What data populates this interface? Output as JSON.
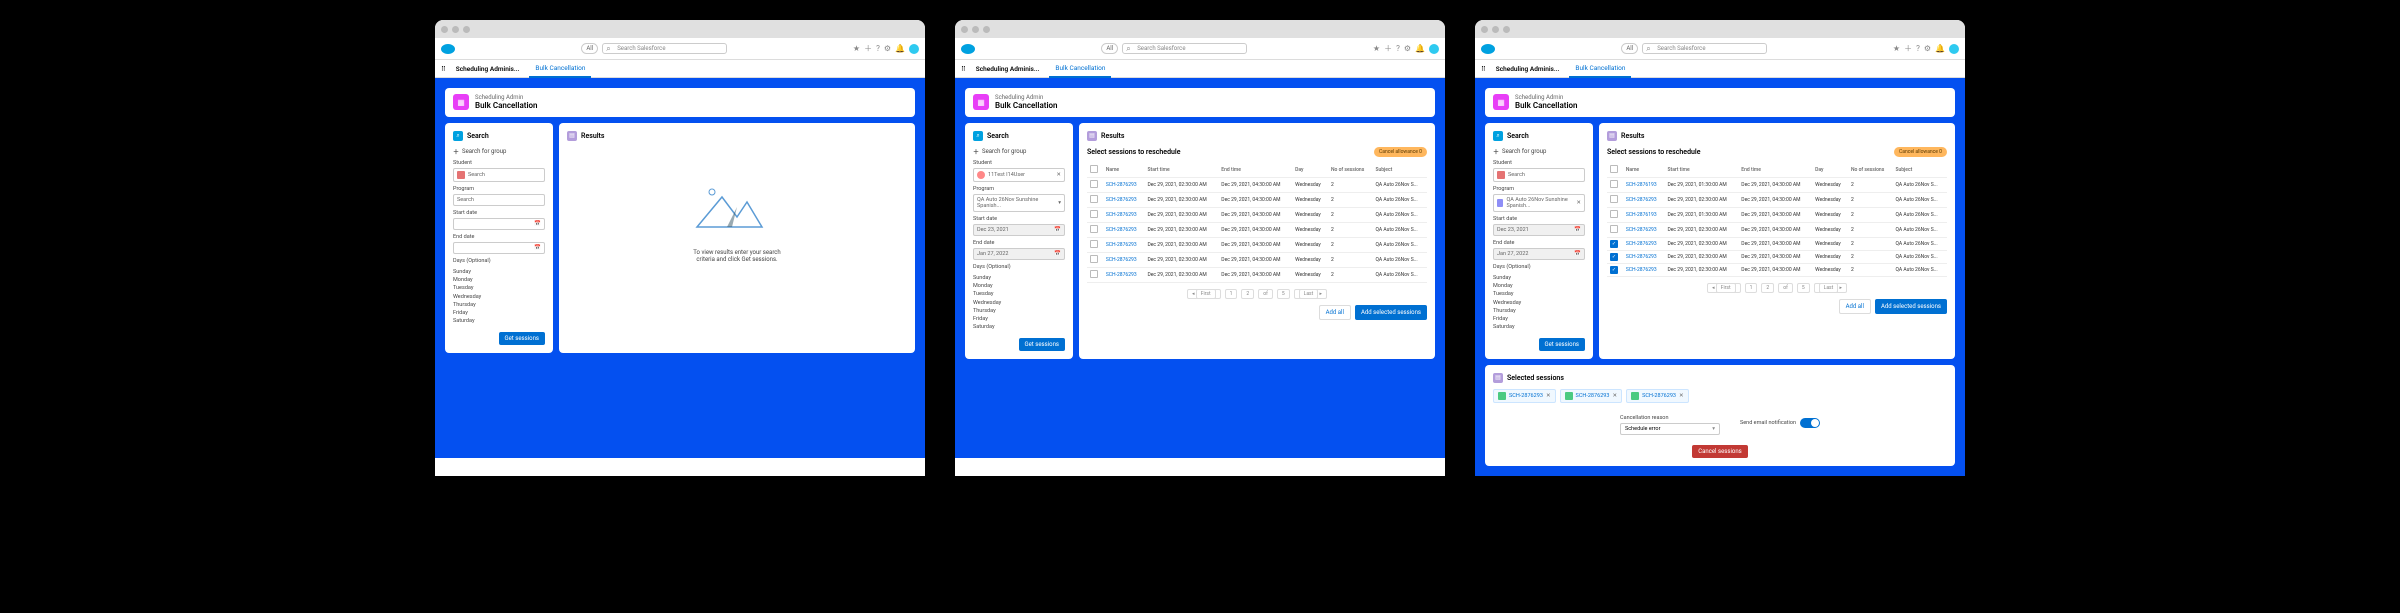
{
  "global": {
    "searchScope": "All",
    "searchPlaceholder": "Search Salesforce",
    "appName": "Scheduling Adminis...",
    "activeTab": "Bulk Cancellation",
    "header": {
      "sub": "Scheduling Admin",
      "main": "Bulk Cancellation"
    }
  },
  "searchCard": {
    "title": "Search",
    "searchGroup": "Search for group",
    "studentLabel": "Student",
    "searchPlaceholder": "Search",
    "programLabel": "Program",
    "startDateLabel": "Start date",
    "endDateLabel": "End date",
    "daysLabel": "Days (Optional)",
    "days": [
      "Sunday",
      "Monday",
      "Tuesday",
      "Wednesday",
      "Thursday",
      "Friday",
      "Saturday"
    ],
    "getBtn": "Get sessions"
  },
  "resultsCard": {
    "title": "Results",
    "emptyMsg1": "To view results enter your search",
    "emptyMsg2": "criteria and click Get sessions.",
    "selectTitle": "Select sessions to reschedule",
    "cancelAllowance": "Cancel allowance 0",
    "addAll": "Add all",
    "addSelected": "Add selected sessions",
    "pager": {
      "first": "First",
      "last": "Last",
      "page1": "1",
      "page2": "2",
      "of": "of",
      "total": "5"
    }
  },
  "columns": [
    "Name",
    "Start time",
    "End time",
    "Day",
    "No of sessions",
    "Subject"
  ],
  "panel2": {
    "student": "11Test I14User",
    "program": "QA Auto 26Nov Sunshine Spanish...",
    "startDate": "Dec 23, 2021",
    "endDate": "Jan 27, 2022",
    "rows": [
      {
        "name": "SCH-2876293",
        "start": "Dec 29, 2021, 02:30:00 AM",
        "end": "Dec 29, 2021, 04:30:00 AM",
        "day": "Wednesday",
        "n": "2",
        "subj": "QA Auto 26Nov S..."
      },
      {
        "name": "SCH-2876293",
        "start": "Dec 29, 2021, 02:30:00 AM",
        "end": "Dec 29, 2021, 04:30:00 AM",
        "day": "Wednesday",
        "n": "2",
        "subj": "QA Auto 26Nov S..."
      },
      {
        "name": "SCH-2876293",
        "start": "Dec 29, 2021, 02:30:00 AM",
        "end": "Dec 29, 2021, 04:30:00 AM",
        "day": "Wednesday",
        "n": "2",
        "subj": "QA Auto 26Nov S..."
      },
      {
        "name": "SCH-2876293",
        "start": "Dec 29, 2021, 02:30:00 AM",
        "end": "Dec 29, 2021, 04:30:00 AM",
        "day": "Wednesday",
        "n": "2",
        "subj": "QA Auto 26Nov S..."
      },
      {
        "name": "SCH-2876293",
        "start": "Dec 29, 2021, 02:30:00 AM",
        "end": "Dec 29, 2021, 04:30:00 AM",
        "day": "Wednesday",
        "n": "2",
        "subj": "QA Auto 26Nov S..."
      },
      {
        "name": "SCH-2876293",
        "start": "Dec 29, 2021, 02:30:00 AM",
        "end": "Dec 29, 2021, 04:30:00 AM",
        "day": "Wednesday",
        "n": "2",
        "subj": "QA Auto 26Nov S..."
      },
      {
        "name": "SCH-2876293",
        "start": "Dec 29, 2021, 02:30:00 AM",
        "end": "Dec 29, 2021, 04:30:00 AM",
        "day": "Wednesday",
        "n": "2",
        "subj": "QA Auto 26Nov S..."
      }
    ]
  },
  "panel3": {
    "student": "Search",
    "program": "QA Auto 26Nov Sunshine Spanish...",
    "startDate": "Dec 23, 2021",
    "endDate": "Jan 27, 2022",
    "rows": [
      {
        "chk": false,
        "name": "SCH-2876193",
        "start": "Dec 29, 2021, 01:30:00 AM",
        "end": "Dec 29, 2021, 04:30:00 AM",
        "day": "Wednesday",
        "n": "2",
        "subj": "QA Auto 26Nov S..."
      },
      {
        "chk": false,
        "name": "SCH-2876293",
        "start": "Dec 29, 2021, 02:30:00 AM",
        "end": "Dec 29, 2021, 04:30:00 AM",
        "day": "Wednesday",
        "n": "2",
        "subj": "QA Auto 26Nov S..."
      },
      {
        "chk": false,
        "name": "SCH-2876193",
        "start": "Dec 29, 2021, 01:30:00 AM",
        "end": "Dec 29, 2021, 04:30:00 AM",
        "day": "Wednesday",
        "n": "2",
        "subj": "QA Auto 26Nov S..."
      },
      {
        "chk": false,
        "name": "SCH-2876293",
        "start": "Dec 29, 2021, 02:30:00 AM",
        "end": "Dec 29, 2021, 04:30:00 AM",
        "day": "Wednesday",
        "n": "2",
        "subj": "QA Auto 26Nov S..."
      },
      {
        "chk": true,
        "name": "SCH-2876293",
        "start": "Dec 29, 2021, 02:30:00 AM",
        "end": "Dec 29, 2021, 04:30:00 AM",
        "day": "Wednesday",
        "n": "2",
        "subj": "QA Auto 26Nov S..."
      },
      {
        "chk": true,
        "name": "SCH-2876293",
        "start": "Dec 29, 2021, 02:30:00 AM",
        "end": "Dec 29, 2021, 04:30:00 AM",
        "day": "Wednesday",
        "n": "2",
        "subj": "QA Auto 26Nov S..."
      },
      {
        "chk": true,
        "name": "SCH-2876293",
        "start": "Dec 29, 2021, 02:30:00 AM",
        "end": "Dec 29, 2021, 04:30:00 AM",
        "day": "Wednesday",
        "n": "2",
        "subj": "QA Auto 26Nov S..."
      }
    ],
    "selected": {
      "title": "Selected sessions",
      "chips": [
        "SCH-2876293",
        "SCH-2876293",
        "SCH-2876293"
      ],
      "reasonLabel": "Cancellation reason",
      "reason": "Schedule error",
      "notifLabel": "Send email notification",
      "cancelBtn": "Cancel sessions"
    }
  }
}
